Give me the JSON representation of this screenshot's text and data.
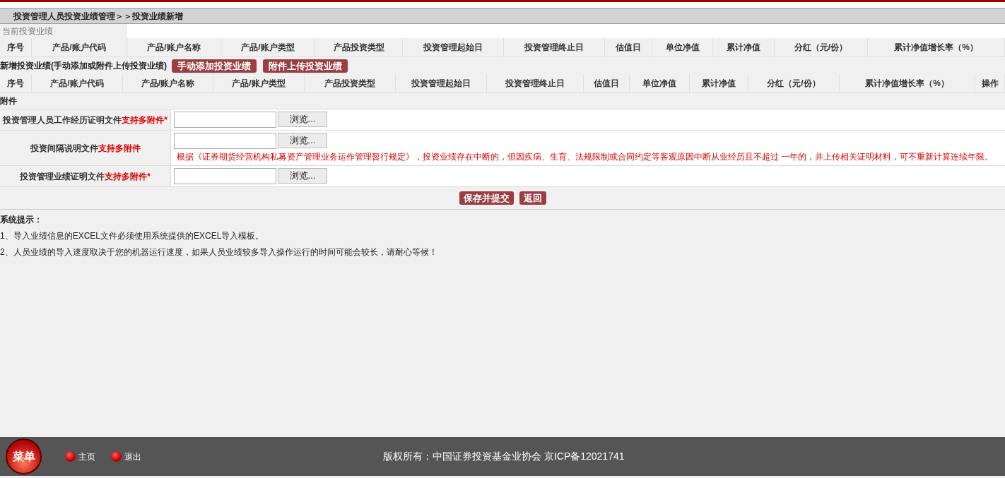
{
  "breadcrumb": "投资管理人员投资业绩管理＞＞投资业绩新增",
  "current_section": {
    "title": "当前投资业绩",
    "columns": [
      "序号",
      "产品/账户代码",
      "产品/账户名称",
      "产品/账户类型",
      "产品投资类型",
      "投资管理起始日",
      "投资管理终止日",
      "估值日",
      "单位净值",
      "累计净值",
      "分红（元/份）",
      "累计净值增长率（%）"
    ]
  },
  "new_section": {
    "title": "新增投资业绩(手动添加或附件上传投资业绩)",
    "buttons": [
      "手动添加投资业绩",
      "附件上传投资业绩"
    ],
    "columns": [
      "序号",
      "产品/账户代码",
      "产品/账户名称",
      "产品/账户类型",
      "产品投资类型",
      "投资管理起始日",
      "投资管理终止日",
      "估值日",
      "单位净值",
      "累计净值",
      "分红（元/份）",
      "累计净值增长率（%）",
      "操作"
    ]
  },
  "attachments": {
    "title": "附件",
    "rows": [
      {
        "label": "投资管理人员工作经历证明文件",
        "highlight": "支持多附件*",
        "browse": "浏览...",
        "note": null
      },
      {
        "label": "投资间隔说明文件",
        "highlight": "支持多附件",
        "browse": "浏览...",
        "note": "根据《证券期货经营机构私募资产管理业务运作管理暂行规定》，投资业绩存在中断的，但因疾病、生育、法规限制或合同约定等客观原因中断从业经历且不超过 一年的，并上传相关证明材料，可不重新计算连续年限。"
      },
      {
        "label": "投资管理业绩证明文件",
        "highlight": "支持多附件*",
        "browse": "浏览...",
        "note": null
      }
    ]
  },
  "actions": [
    "保存并提交",
    "返回"
  ],
  "tips": {
    "title": "系统提示：",
    "items": [
      "1、导入业绩信息的EXCEL文件必须使用系统提供的EXCEL导入模板。",
      "2、人员业绩的导入速度取决于您的机器运行速度，如果人员业绩较多导入操作运行的时间可能会较长，请耐心等候！"
    ]
  },
  "footer": {
    "menu": "菜单",
    "links": [
      "主页",
      "退出"
    ],
    "copyright": "版权所有：中国证券投资基金业协会 京ICP备12021741"
  }
}
